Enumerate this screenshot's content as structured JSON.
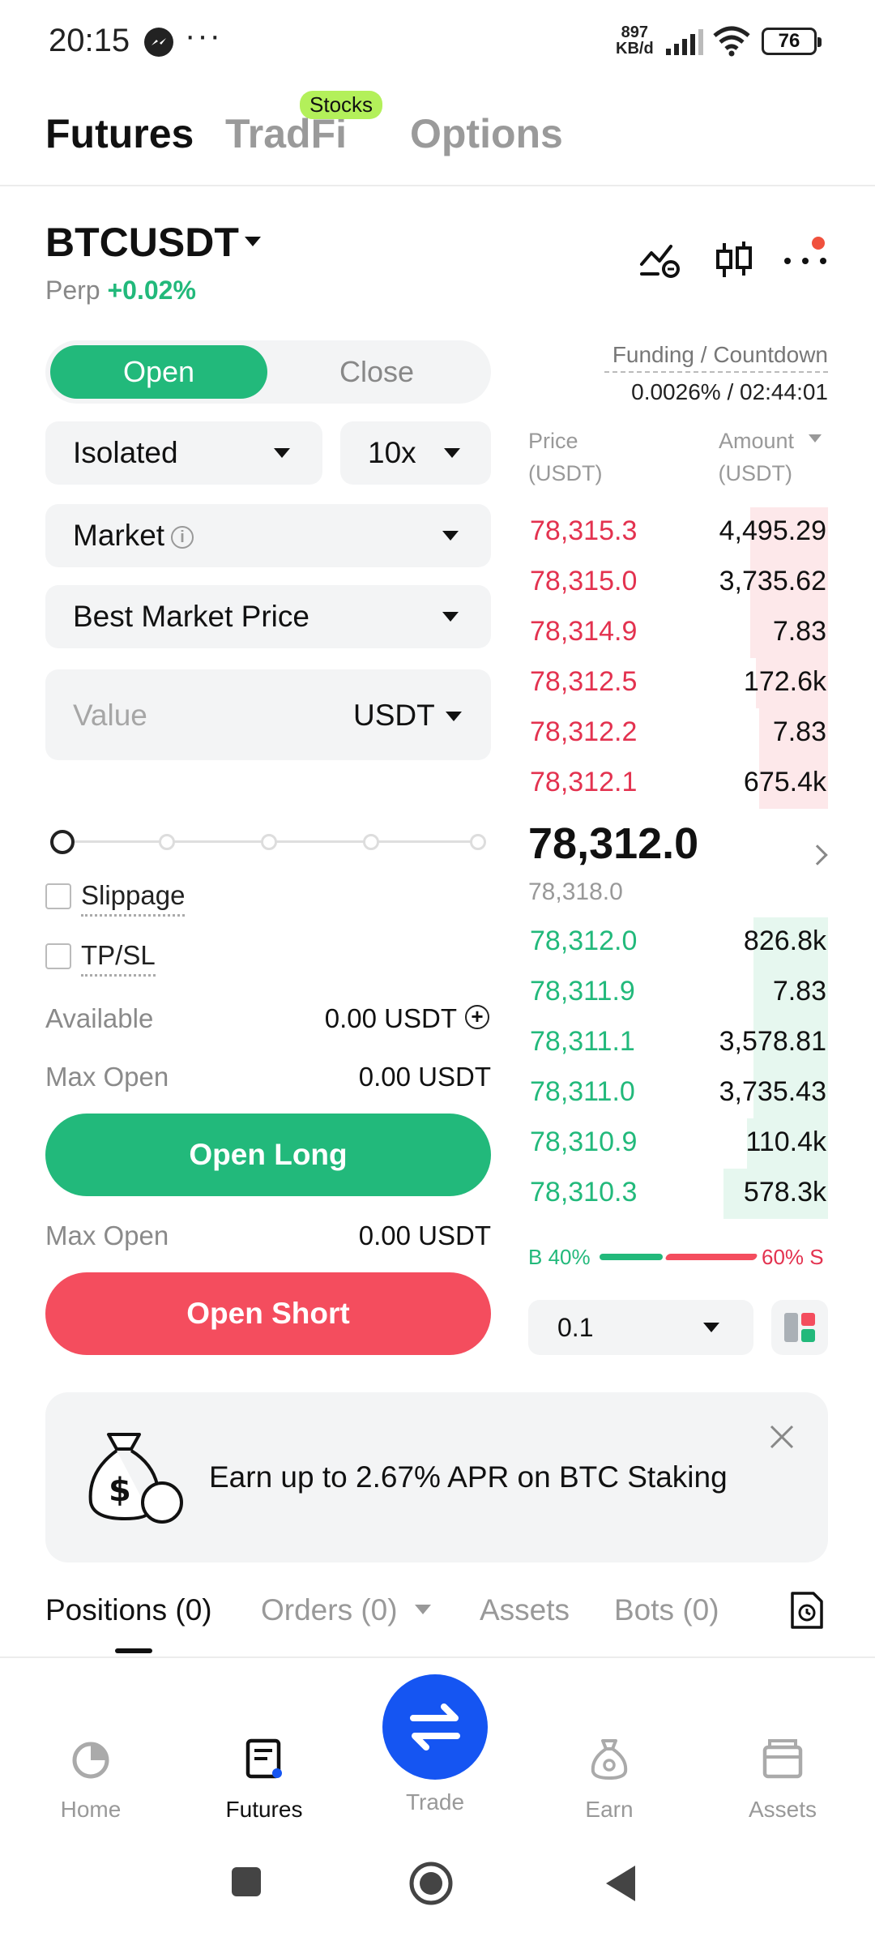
{
  "status_bar": {
    "time": "20:15",
    "more": "···",
    "net_speed_value": "897",
    "net_speed_unit": "KB/d",
    "battery": "76"
  },
  "top_tabs": [
    {
      "label": "Futures",
      "active": true
    },
    {
      "label": "TradFi",
      "active": false,
      "badge": "Stocks"
    },
    {
      "label": "Options",
      "active": false
    }
  ],
  "instrument": {
    "symbol": "BTCUSDT",
    "type": "Perp",
    "change": "+0.02%"
  },
  "order_form": {
    "open_label": "Open",
    "close_label": "Close",
    "margin_mode": "Isolated",
    "leverage": "10x",
    "order_type": "Market",
    "price_mode": "Best Market Price",
    "value_placeholder": "Value",
    "value_unit": "USDT",
    "slippage_label": "Slippage",
    "tpsl_label": "TP/SL",
    "available_label": "Available",
    "available_value": "0.00 USDT",
    "max_open_label": "Max Open",
    "max_open_long": "0.00 USDT",
    "open_long_label": "Open Long",
    "max_open_short": "0.00 USDT",
    "open_short_label": "Open Short"
  },
  "order_book": {
    "funding_label": "Funding / Countdown",
    "funding_value": "0.0026% / 02:44:01",
    "price_header": "Price",
    "price_unit": "(USDT)",
    "amount_header": "Amount",
    "amount_unit": "(USDT)",
    "asks": [
      {
        "price": "78,315.3",
        "amount": "4,495.29",
        "depth": 0.26
      },
      {
        "price": "78,315.0",
        "amount": "3,735.62",
        "depth": 0.26
      },
      {
        "price": "78,314.9",
        "amount": "7.83",
        "depth": 0.26
      },
      {
        "price": "78,312.5",
        "amount": "172.6k",
        "depth": 0.24
      },
      {
        "price": "78,312.2",
        "amount": "7.83",
        "depth": 0.23
      },
      {
        "price": "78,312.1",
        "amount": "675.4k",
        "depth": 0.23
      }
    ],
    "last_price": "78,312.0",
    "mark_price": "78,318.0",
    "bids": [
      {
        "price": "78,312.0",
        "amount": "826.8k",
        "depth": 0.25
      },
      {
        "price": "78,311.9",
        "amount": "7.83",
        "depth": 0.25
      },
      {
        "price": "78,311.1",
        "amount": "3,578.81",
        "depth": 0.25
      },
      {
        "price": "78,311.0",
        "amount": "3,735.43",
        "depth": 0.25
      },
      {
        "price": "78,310.9",
        "amount": "110.4k",
        "depth": 0.27
      },
      {
        "price": "78,310.3",
        "amount": "578.3k",
        "depth": 0.35
      }
    ],
    "buy_ratio": "B 40%",
    "sell_ratio": "60% S",
    "precision": "0.1"
  },
  "banner": {
    "text": "Earn up to 2.67% APR on BTC Staking"
  },
  "position_tabs": [
    {
      "label": "Positions (0)",
      "active": true
    },
    {
      "label": "Orders (0)",
      "active": false
    },
    {
      "label": "Assets",
      "active": false
    },
    {
      "label": "Bots (0)",
      "active": false
    }
  ],
  "bottom_nav": [
    {
      "label": "Home",
      "icon": "home-icon"
    },
    {
      "label": "Futures",
      "icon": "futures-icon",
      "active": true
    },
    {
      "label": "Trade",
      "icon": "trade-icon"
    },
    {
      "label": "Earn",
      "icon": "earn-icon"
    },
    {
      "label": "Assets",
      "icon": "wallet-icon"
    }
  ],
  "colors": {
    "green": "#22b97b",
    "red": "#f44d5e",
    "accent_blue": "#1555f2",
    "badge": "#b3f05a"
  }
}
